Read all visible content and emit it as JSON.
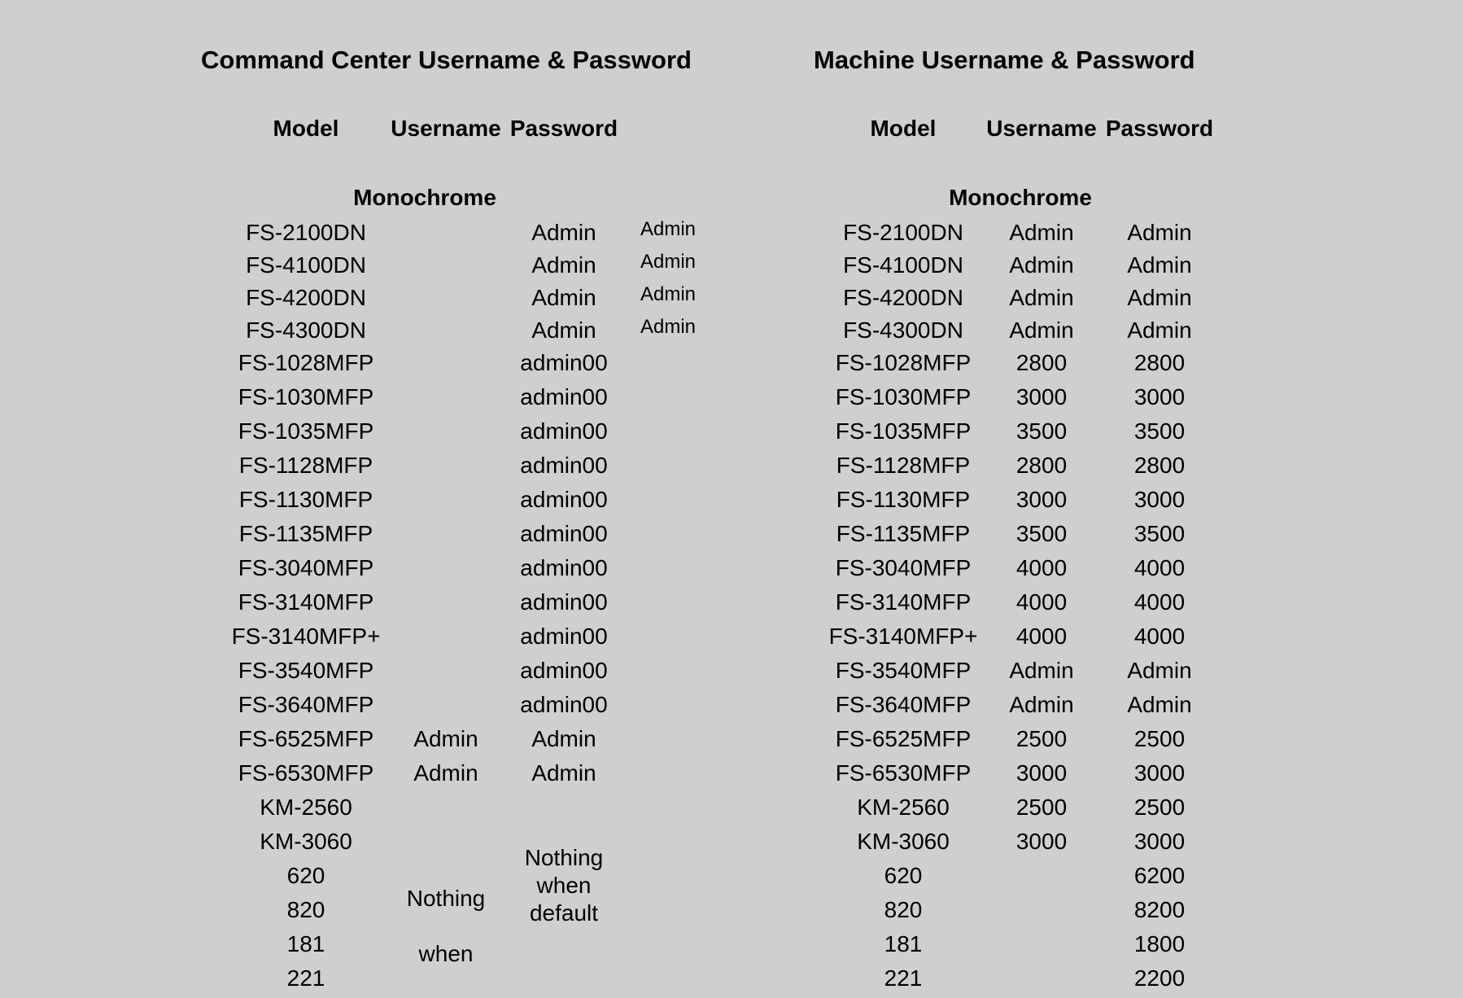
{
  "command_center": {
    "title": "Command Center Username & Password",
    "headers": {
      "model": "Model",
      "username": "Username",
      "password": "Password"
    },
    "section": "Monochrome",
    "rows": [
      {
        "model": "FS-2100DN",
        "username": "",
        "password": "Admin",
        "extra": "Admin"
      },
      {
        "model": "FS-4100DN",
        "username": "",
        "password": "Admin",
        "extra": "Admin"
      },
      {
        "model": "FS-4200DN",
        "username": "",
        "password": "Admin",
        "extra": "Admin"
      },
      {
        "model": "FS-4300DN",
        "username": "",
        "password": "Admin",
        "extra": "Admin"
      },
      {
        "model": "FS-1028MFP",
        "username": "",
        "password": "admin00",
        "extra": ""
      },
      {
        "model": "FS-1030MFP",
        "username": "",
        "password": "admin00",
        "extra": ""
      },
      {
        "model": "FS-1035MFP",
        "username": "",
        "password": "admin00",
        "extra": ""
      },
      {
        "model": "FS-1128MFP",
        "username": "",
        "password": "admin00",
        "extra": ""
      },
      {
        "model": "FS-1130MFP",
        "username": "",
        "password": "admin00",
        "extra": ""
      },
      {
        "model": "FS-1135MFP",
        "username": "",
        "password": "admin00",
        "extra": ""
      },
      {
        "model": "FS-3040MFP",
        "username": "",
        "password": "admin00",
        "extra": ""
      },
      {
        "model": "FS-3140MFP",
        "username": "",
        "password": "admin00",
        "extra": ""
      },
      {
        "model": "FS-3140MFP+",
        "username": "",
        "password": "admin00",
        "extra": ""
      },
      {
        "model": "FS-3540MFP",
        "username": "",
        "password": "admin00",
        "extra": ""
      },
      {
        "model": "FS-3640MFP",
        "username": "",
        "password": "admin00",
        "extra": ""
      },
      {
        "model": "FS-6525MFP",
        "username": "Admin",
        "password": "Admin",
        "extra": ""
      },
      {
        "model": "FS-6530MFP",
        "username": "Admin",
        "password": "Admin",
        "extra": ""
      },
      {
        "model": "KM-2560",
        "username": "",
        "password": "",
        "extra": ""
      },
      {
        "model": "KM-3060",
        "username": "",
        "password": "",
        "extra": ""
      },
      {
        "model": "620",
        "username": "",
        "password": "",
        "extra": ""
      },
      {
        "model": "820",
        "username": "",
        "password": "",
        "extra": ""
      },
      {
        "model": "181",
        "username": "",
        "password": "",
        "extra": ""
      },
      {
        "model": "221",
        "username": "",
        "password": "",
        "extra": ""
      }
    ],
    "notes": {
      "username_nothing": "Nothing",
      "username_when": "when",
      "password_note": "Nothing when default"
    }
  },
  "machine": {
    "title": "Machine Username & Password",
    "headers": {
      "model": "Model",
      "username": "Username",
      "password": "Password"
    },
    "section": "Monochrome",
    "rows": [
      {
        "model": "FS-2100DN",
        "username": "Admin",
        "password": "Admin"
      },
      {
        "model": "FS-4100DN",
        "username": "Admin",
        "password": "Admin"
      },
      {
        "model": "FS-4200DN",
        "username": "Admin",
        "password": "Admin"
      },
      {
        "model": "FS-4300DN",
        "username": "Admin",
        "password": "Admin"
      },
      {
        "model": "FS-1028MFP",
        "username": "2800",
        "password": "2800"
      },
      {
        "model": "FS-1030MFP",
        "username": "3000",
        "password": "3000"
      },
      {
        "model": "FS-1035MFP",
        "username": "3500",
        "password": "3500"
      },
      {
        "model": "FS-1128MFP",
        "username": "2800",
        "password": "2800"
      },
      {
        "model": "FS-1130MFP",
        "username": "3000",
        "password": "3000"
      },
      {
        "model": "FS-1135MFP",
        "username": "3500",
        "password": "3500"
      },
      {
        "model": "FS-3040MFP",
        "username": "4000",
        "password": "4000"
      },
      {
        "model": "FS-3140MFP",
        "username": "4000",
        "password": "4000"
      },
      {
        "model": "FS-3140MFP+",
        "username": "4000",
        "password": "4000"
      },
      {
        "model": "FS-3540MFP",
        "username": "Admin",
        "password": "Admin"
      },
      {
        "model": "FS-3640MFP",
        "username": "Admin",
        "password": "Admin"
      },
      {
        "model": "FS-6525MFP",
        "username": "2500",
        "password": "2500"
      },
      {
        "model": "FS-6530MFP",
        "username": "3000",
        "password": "3000"
      },
      {
        "model": "KM-2560",
        "username": "2500",
        "password": "2500"
      },
      {
        "model": "KM-3060",
        "username": "3000",
        "password": "3000"
      },
      {
        "model": "620",
        "username": "",
        "password": "6200"
      },
      {
        "model": "820",
        "username": "",
        "password": "8200"
      },
      {
        "model": "181",
        "username": "",
        "password": "1800"
      },
      {
        "model": "221",
        "username": "",
        "password": "2200"
      }
    ]
  }
}
